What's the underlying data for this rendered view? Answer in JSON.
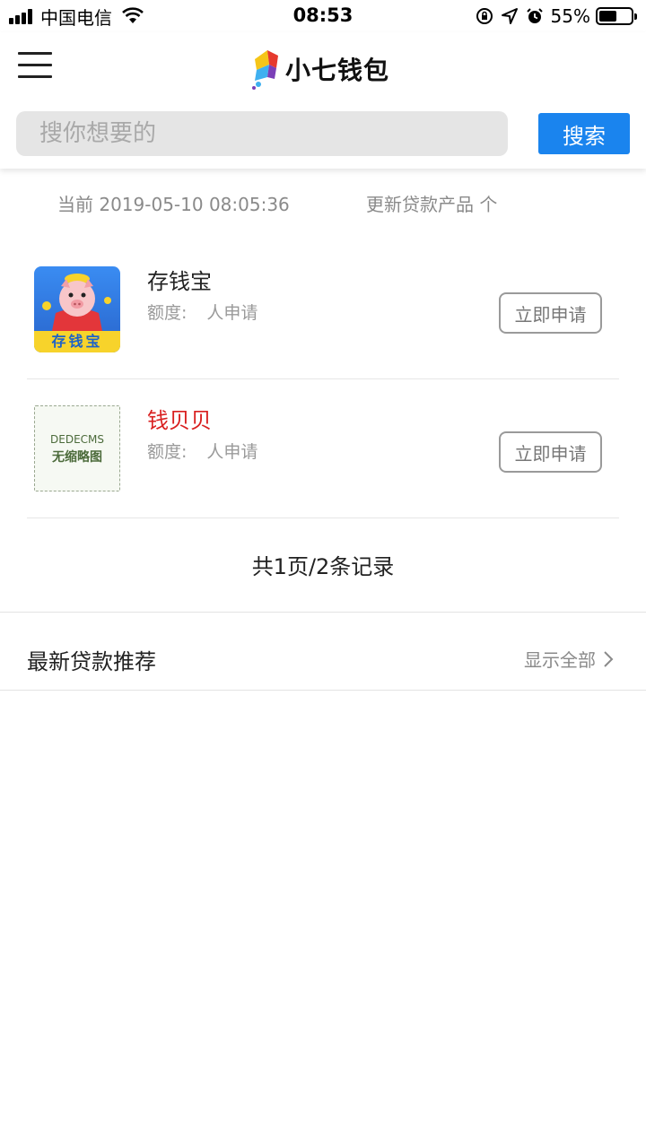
{
  "status_bar": {
    "carrier": "中国电信",
    "time": "08:53",
    "battery_pct": "55%",
    "battery_level": 0.55
  },
  "header": {
    "logo_text": "小七钱包",
    "search_placeholder": "搜你想要的",
    "search_button": "搜索",
    "accent_color": "#1a84ee"
  },
  "update_info": {
    "current": "当前 2019-05-10 08:05:36",
    "updated": "更新贷款产品 个"
  },
  "products": [
    {
      "name": "存钱宝",
      "thumb_text": "存钱宝",
      "quota_label": "额度:",
      "applicants": "人申请",
      "apply": "立即申请"
    },
    {
      "name": "钱贝贝",
      "thumb_line1": "DEDECMS",
      "thumb_line2": "无缩略图",
      "quota_label": "额度:",
      "applicants": "人申请",
      "apply": "立即申请",
      "name_color": "#d92020"
    }
  ],
  "pagination": "共1页/2条记录",
  "recommend": {
    "title": "最新贷款推荐",
    "show_all": "显示全部"
  }
}
